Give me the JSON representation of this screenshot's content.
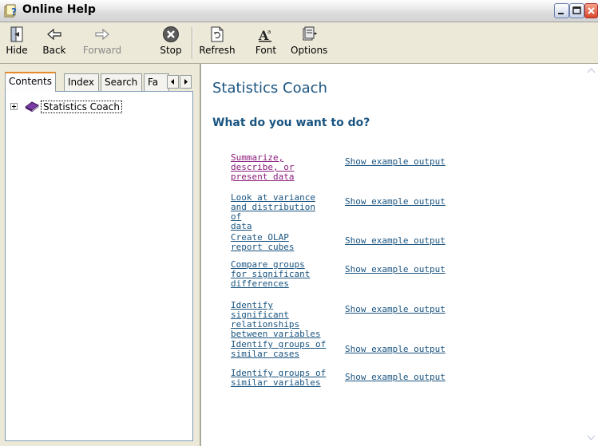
{
  "window": {
    "title": "Online Help"
  },
  "toolbar": {
    "hide": "Hide",
    "back": "Back",
    "forward": "Forward",
    "stop": "Stop",
    "refresh": "Refresh",
    "font": "Font",
    "options": "Options"
  },
  "nav": {
    "tabs": [
      "Contents",
      "Index",
      "Search",
      "Fa"
    ],
    "tree": [
      {
        "label": "Statistics Coach",
        "icon": "book-icon",
        "expanded": false
      }
    ]
  },
  "main": {
    "title": "Statistics Coach",
    "heading": "What do you want to do?",
    "options": [
      {
        "lines": [
          "Summarize,",
          "describe, or",
          "present data"
        ],
        "example": "Show example output",
        "visited": true
      },
      {
        "lines": [
          "Look at variance",
          "and distribution of",
          "data"
        ],
        "example": "Show example output",
        "visited": false
      },
      {
        "lines": [
          "Create OLAP",
          "report cubes"
        ],
        "example": "Show example output",
        "visited": false
      },
      {
        "lines": [
          "Compare groups",
          "for significant",
          "differences"
        ],
        "example": "Show example output",
        "visited": false
      },
      {
        "lines": [
          "Identify significant",
          "relationships",
          "between variables"
        ],
        "example": "Show example output",
        "visited": false
      },
      {
        "lines": [
          "Identify groups of",
          "similar cases"
        ],
        "example": "Show example output",
        "visited": false
      },
      {
        "lines": [
          "Identify groups of",
          "similar variables"
        ],
        "example": "Show example output",
        "visited": false
      }
    ]
  },
  "colors": {
    "link": "#1a5480",
    "visited_link": "#8b1a7a",
    "heading": "#1a5480"
  }
}
